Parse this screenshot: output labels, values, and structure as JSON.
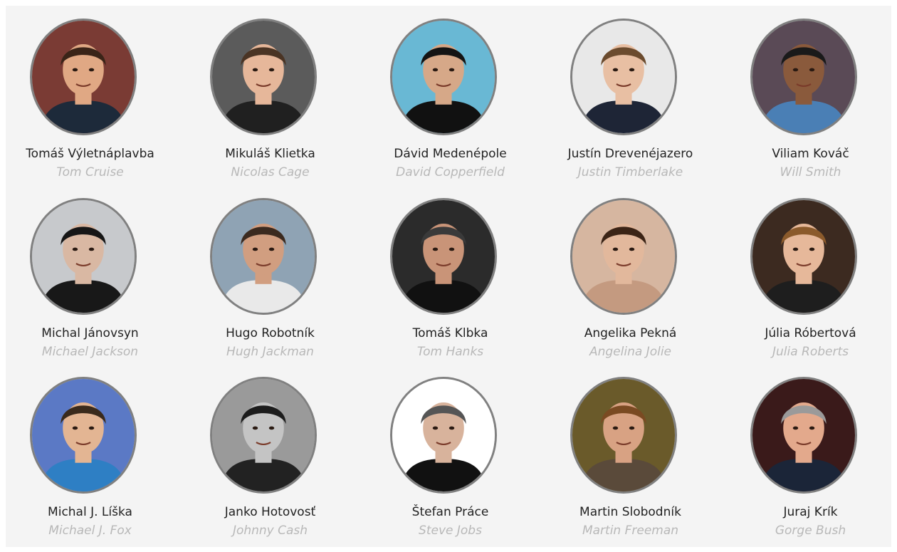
{
  "people": [
    {
      "name": "Tomáš Výletnáplavba",
      "original": "Tom Cruise",
      "bg": "#7a3b34",
      "skin": "#e0a884",
      "hair": "#3a2418",
      "shirt": "#1d2a3a",
      "icon": "portrait-icon"
    },
    {
      "name": "Mikuláš Klietka",
      "original": "Nicolas Cage",
      "bg": "#5b5b5b",
      "skin": "#e6b79a",
      "hair": "#4a3424",
      "shirt": "#202020",
      "icon": "portrait-icon"
    },
    {
      "name": "Dávid Medenépole",
      "original": "David Copperfield",
      "bg": "#69b8d4",
      "skin": "#d6a888",
      "hair": "#141414",
      "shirt": "#111111",
      "icon": "portrait-icon"
    },
    {
      "name": "Justín Drevenéjazero",
      "original": "Justin Timberlake",
      "bg": "#e8e8e8",
      "skin": "#e8bfa3",
      "hair": "#6b4b2e",
      "shirt": "#1e2536",
      "icon": "portrait-icon"
    },
    {
      "name": "Viliam Kováč",
      "original": "Will Smith",
      "bg": "#5a4a56",
      "skin": "#8a5a3c",
      "hair": "#1a1a1a",
      "shirt": "#4a7fb5",
      "icon": "portrait-icon"
    },
    {
      "name": "Michal Jánovsyn",
      "original": "Michael Jackson",
      "bg": "#c7c9cc",
      "skin": "#d9b8a3",
      "hair": "#161616",
      "shirt": "#181818",
      "icon": "portrait-icon"
    },
    {
      "name": "Hugo Robotník",
      "original": "Hugh Jackman",
      "bg": "#8fa3b4",
      "skin": "#d19e80",
      "hair": "#3b2a1f",
      "shirt": "#e9e9e9",
      "icon": "portrait-icon"
    },
    {
      "name": "Tomáš Klbka",
      "original": "Tom Hanks",
      "bg": "#2b2b2b",
      "skin": "#c99478",
      "hair": "#3a3a3a",
      "shirt": "#111111",
      "icon": "portrait-icon"
    },
    {
      "name": "Angelika Pekná",
      "original": "Angelina Jolie",
      "bg": "#d6b6a0",
      "skin": "#e2b89c",
      "hair": "#3b2416",
      "shirt": "#c49a80",
      "icon": "portrait-icon"
    },
    {
      "name": "Júlia Róbertová",
      "original": "Julia Roberts",
      "bg": "#3c2a20",
      "skin": "#e6b89a",
      "hair": "#8b5a2b",
      "shirt": "#1e1e1e",
      "icon": "portrait-icon"
    },
    {
      "name": "Michal J. Líška",
      "original": "Michael J. Fox",
      "bg": "#5b79c5",
      "skin": "#e3b593",
      "hair": "#3a2a1c",
      "shirt": "#2e7fc4",
      "icon": "portrait-icon"
    },
    {
      "name": "Janko Hotovosť",
      "original": "Johnny Cash",
      "bg": "#9a9a9a",
      "skin": "#c4c4c4",
      "hair": "#1c1c1c",
      "shirt": "#222222",
      "icon": "portrait-icon"
    },
    {
      "name": "Štefan Práce",
      "original": "Steve Jobs",
      "bg": "#ffffff",
      "skin": "#d8b39c",
      "hair": "#555555",
      "shirt": "#111111",
      "icon": "portrait-icon"
    },
    {
      "name": "Martin Slobodník",
      "original": "Martin Freeman",
      "bg": "#6a5a2a",
      "skin": "#d8a283",
      "hair": "#7a4a22",
      "shirt": "#5a4a3a",
      "icon": "portrait-icon"
    },
    {
      "name": "Juraj Krík",
      "original": "Gorge Bush",
      "bg": "#3a1a1a",
      "skin": "#e3a98c",
      "hair": "#9a9a9a",
      "shirt": "#1b2538",
      "icon": "portrait-icon"
    }
  ]
}
